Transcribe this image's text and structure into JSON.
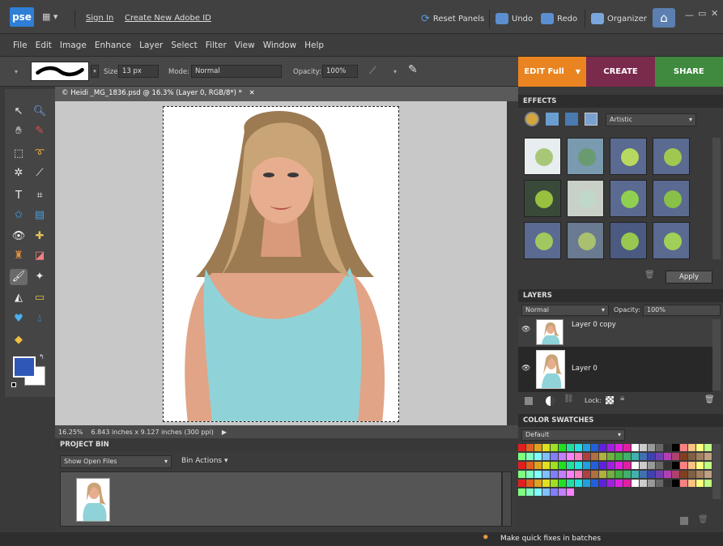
{
  "topbar": {
    "logo": "pse",
    "sign_in": "Sign In",
    "create_id": "Create New Adobe ID",
    "reset_panels": "Reset Panels",
    "undo": "Undo",
    "redo": "Redo",
    "organizer": "Organizer"
  },
  "menu": [
    "File",
    "Edit",
    "Image",
    "Enhance",
    "Layer",
    "Select",
    "Filter",
    "View",
    "Window",
    "Help"
  ],
  "options": {
    "size_label": "Size:",
    "size_value": "13 px",
    "mode_label": "Mode:",
    "mode_value": "Normal",
    "opacity_label": "Opacity:",
    "opacity_value": "100%"
  },
  "mode_tabs": {
    "edit": "EDIT Full",
    "create": "CREATE",
    "share": "SHARE"
  },
  "document": {
    "tab_title": "© Heidi _MG_1836.psd @ 16.3% (Layer 0, RGB/8*) *",
    "zoom": "16.25%",
    "dimensions": "6.843 inches x 9.127 inches (300 ppi)"
  },
  "project_bin": {
    "title": "PROJECT BIN",
    "dropdown": "Show Open Files",
    "bin_actions": "Bin Actions"
  },
  "effects": {
    "title": "EFFECTS",
    "category": "Artistic",
    "apply": "Apply"
  },
  "layers": {
    "title": "LAYERS",
    "blend_mode": "Normal",
    "opacity_label": "Opacity:",
    "opacity_value": "100%",
    "lock_label": "Lock:",
    "items": [
      {
        "name": "Layer 0 copy"
      },
      {
        "name": "Layer 0"
      }
    ]
  },
  "swatches": {
    "title": "COLOR SWATCHES",
    "preset": "Default",
    "colors": [
      "#e02020",
      "#e06020",
      "#e0a020",
      "#e0e020",
      "#a0e020",
      "#20e020",
      "#20e0a0",
      "#20e0e0",
      "#20a0e0",
      "#2060e0",
      "#6020e0",
      "#a020e0",
      "#e020e0",
      "#e020a0",
      "#ffffff",
      "#cccccc",
      "#999999",
      "#666666",
      "#333333",
      "#000000",
      "#ff8080",
      "#ffc080",
      "#ffff80",
      "#c0ff80",
      "#80ff80",
      "#80ffc0",
      "#80ffff",
      "#80c0ff",
      "#8080ff",
      "#c080ff",
      "#ff80ff",
      "#ff80c0",
      "#b04040",
      "#b07040",
      "#b0b040",
      "#70b040",
      "#40b040",
      "#40b070",
      "#40b0b0",
      "#4070b0",
      "#4040b0",
      "#7040b0",
      "#b040b0",
      "#b04070",
      "#804020",
      "#806040",
      "#a08060",
      "#c0a080"
    ]
  },
  "footer": {
    "message": "Make quick fixes in batches"
  }
}
